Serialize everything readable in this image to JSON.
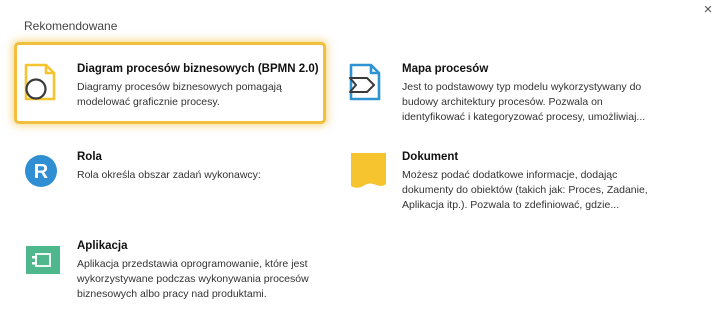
{
  "header": {
    "section_title": "Rekomendowane",
    "close_glyph": "×"
  },
  "accent": {
    "selection_border": "#f2bf3c",
    "bpmn_icon": "#f6c42e",
    "process_map_icon": "#2f93d1",
    "role_icon": "#2f8fd2",
    "document_icon": "#f6c42e",
    "application_icon": "#4eb78c"
  },
  "cards": [
    {
      "id": "bpmn",
      "icon": "bpmn-diagram-icon",
      "title": "Diagram procesów biznesowych (BPMN 2.0)",
      "description": "Diagramy procesów biznesowych pomagają modelować graficznie procesy.",
      "selected": true
    },
    {
      "id": "process-map",
      "icon": "process-map-icon",
      "title": "Mapa procesów",
      "description": "Jest to podstawowy typ modelu wykorzystywany do budowy architektury procesów. Pozwala on identyfikować i kategoryzować procesy, umożliwiaj...",
      "selected": false
    },
    {
      "id": "role",
      "icon": "role-icon",
      "icon_letter": "R",
      "title": "Rola",
      "description": "Rola określa obszar zadań wykonawcy:",
      "selected": false
    },
    {
      "id": "document",
      "icon": "document-icon",
      "title": "Dokument",
      "description": "Możesz podać dodatkowe informacje, dodając dokumenty do obiektów (takich jak: Proces, Zadanie, Aplikacja itp.). Pozwala to zdefiniować, gdzie...",
      "selected": false
    },
    {
      "id": "application",
      "icon": "application-icon",
      "title": "Aplikacja",
      "description": "Aplikacja przedstawia oprogramowanie, które jest wykorzystywane podczas wykonywania procesów biznesowych albo pracy nad produktami.",
      "selected": false
    }
  ]
}
